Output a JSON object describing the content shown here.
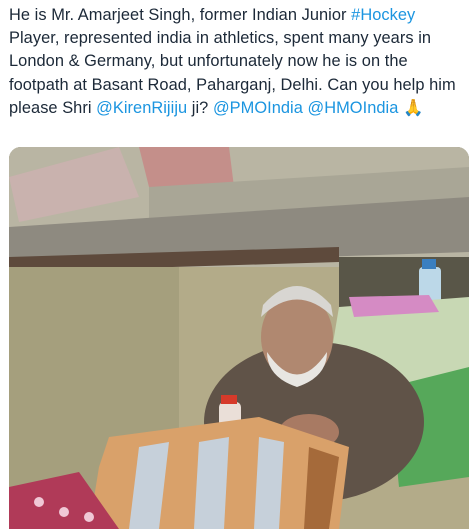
{
  "tweet": {
    "segments": [
      {
        "type": "text",
        "value": "He is Mr. Amarjeet Singh, former Indian Junior "
      },
      {
        "type": "hashtag",
        "value": "#Hockey"
      },
      {
        "type": "text",
        "value": " Player, represented india in athletics, spent many years in London & Germany, but unfortunately now he is on the footpath at Basant Road, Paharganj, Delhi. Can you help him please Shri "
      },
      {
        "type": "mention",
        "value": "@KirenRijiju"
      },
      {
        "type": "text",
        "value": " ji? "
      },
      {
        "type": "mention",
        "value": "@PMOIndia"
      },
      {
        "type": "text",
        "value": " "
      },
      {
        "type": "mention",
        "value": "@HMOIndia"
      },
      {
        "type": "text",
        "value": " "
      },
      {
        "type": "emoji",
        "value": "🙏"
      }
    ]
  },
  "media": {
    "subject_icon": "man-on-footpath-photo"
  },
  "colors": {
    "text": "#1c2938",
    "link": "#1b95e0"
  }
}
